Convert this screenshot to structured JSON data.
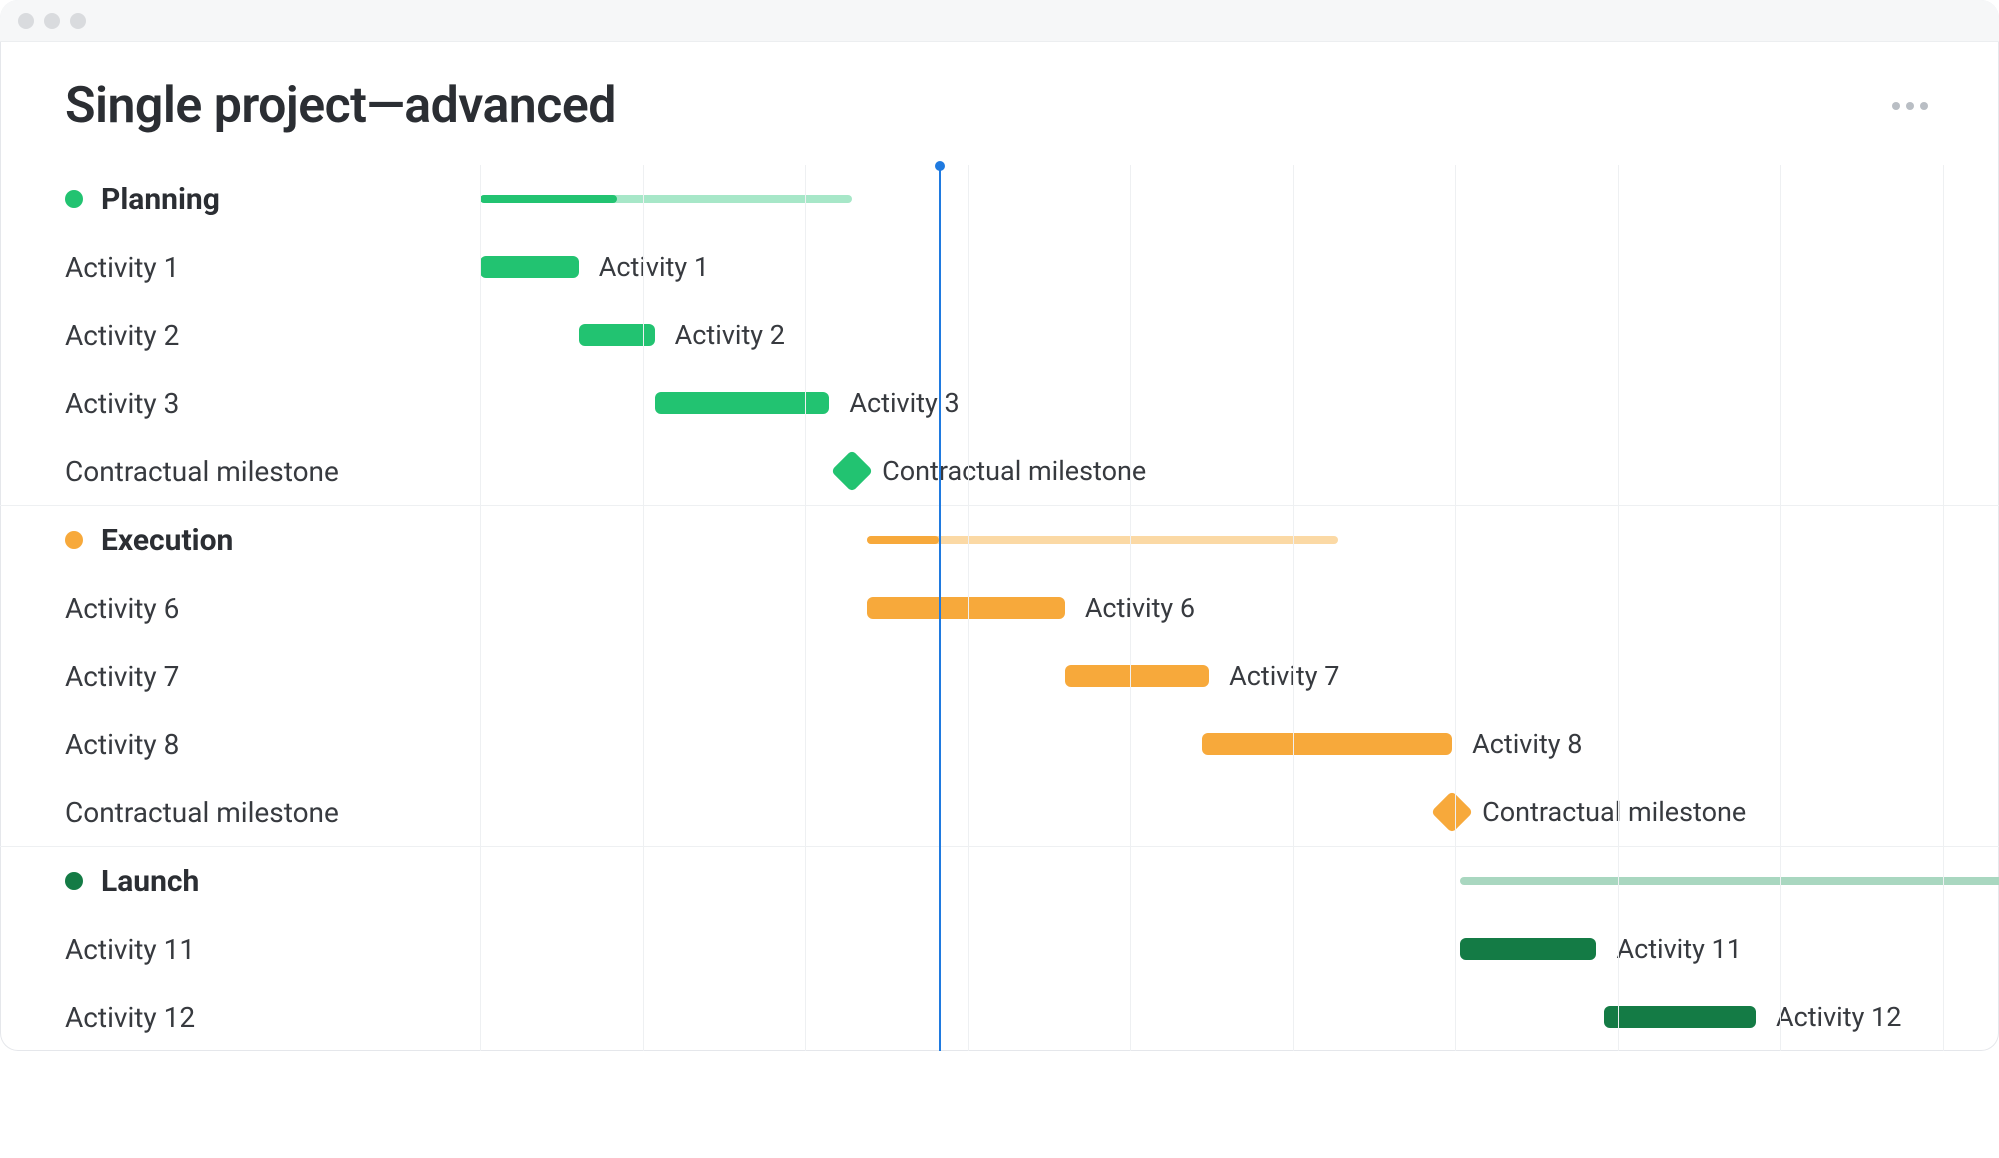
{
  "title": "Single project—advanced",
  "today_position_pct": 30.2,
  "grid_start_pct": 0,
  "grid_step_pct": 10.7,
  "grid_count": 10,
  "colors": {
    "planning": {
      "solid": "#22c371",
      "light": "#a7e7c8"
    },
    "execution": {
      "solid": "#f7a93b",
      "light": "#fbd9a5"
    },
    "launch": {
      "solid": "#147b45",
      "light": "#a9d7c0"
    },
    "today": "#1f7ae0"
  },
  "sections": [
    {
      "id": "planning",
      "name": "Planning",
      "color_key": "planning",
      "summary": {
        "start_pct": 0,
        "width_pct": 24.5,
        "progress_pct": 9.0
      },
      "rows": [
        {
          "type": "bar",
          "label": "Activity 1",
          "bar": {
            "start_pct": 0,
            "width_pct": 6.5
          },
          "bar_label": "Activity 1"
        },
        {
          "type": "bar",
          "label": "Activity 2",
          "bar": {
            "start_pct": 6.5,
            "width_pct": 5.0
          },
          "bar_label": "Activity 2"
        },
        {
          "type": "bar",
          "label": "Activity 3",
          "bar": {
            "start_pct": 11.5,
            "width_pct": 11.5
          },
          "bar_label": "Activity 3"
        },
        {
          "type": "milestone",
          "label": "Contractual milestone",
          "pos_pct": 24.5,
          "bar_label": "Contractual milestone"
        }
      ]
    },
    {
      "id": "execution",
      "name": "Execution",
      "color_key": "execution",
      "summary": {
        "start_pct": 25.5,
        "width_pct": 31.0,
        "progress_pct": 4.7
      },
      "rows": [
        {
          "type": "bar",
          "label": "Activity 6",
          "bar": {
            "start_pct": 25.5,
            "width_pct": 13.0
          },
          "bar_label": "Activity 6"
        },
        {
          "type": "bar",
          "label": "Activity 7",
          "bar": {
            "start_pct": 38.5,
            "width_pct": 9.5
          },
          "bar_label": "Activity 7"
        },
        {
          "type": "bar",
          "label": "Activity 8",
          "bar": {
            "start_pct": 47.5,
            "width_pct": 16.5
          },
          "bar_label": "Activity 8"
        },
        {
          "type": "milestone",
          "label": "Contractual milestone",
          "pos_pct": 64.0,
          "bar_label": "Contractual milestone"
        }
      ]
    },
    {
      "id": "launch",
      "name": "Launch",
      "color_key": "launch",
      "summary": {
        "start_pct": 64.5,
        "width_pct": 40.0,
        "progress_pct": 0
      },
      "rows": [
        {
          "type": "bar",
          "label": "Activity 11",
          "bar": {
            "start_pct": 64.5,
            "width_pct": 9.0
          },
          "bar_label": "Activity 11"
        },
        {
          "type": "bar",
          "label": "Activity 12",
          "bar": {
            "start_pct": 74.0,
            "width_pct": 10.0
          },
          "bar_label": "Activity 12"
        }
      ]
    }
  ],
  "chart_data": {
    "type": "bar",
    "title": "Single project—advanced",
    "today": 3.0,
    "x_range": [
      0,
      10
    ],
    "sections": [
      {
        "name": "Planning",
        "color": "#22c371",
        "summary": {
          "start": 0,
          "end": 2.3,
          "progress_end": 0.85
        },
        "activities": [
          {
            "name": "Activity 1",
            "start": 0.0,
            "end": 0.6
          },
          {
            "name": "Activity 2",
            "start": 0.6,
            "end": 1.1
          },
          {
            "name": "Activity 3",
            "start": 1.1,
            "end": 2.2
          }
        ],
        "milestones": [
          {
            "name": "Contractual milestone",
            "at": 2.3
          }
        ]
      },
      {
        "name": "Execution",
        "color": "#f7a93b",
        "summary": {
          "start": 2.4,
          "end": 5.3,
          "progress_end": 2.85
        },
        "activities": [
          {
            "name": "Activity 6",
            "start": 2.4,
            "end": 3.6
          },
          {
            "name": "Activity 7",
            "start": 3.6,
            "end": 4.5
          },
          {
            "name": "Activity 8",
            "start": 4.45,
            "end": 6.0
          }
        ],
        "milestones": [
          {
            "name": "Contractual milestone",
            "at": 6.0
          }
        ]
      },
      {
        "name": "Launch",
        "color": "#147b45",
        "summary": {
          "start": 6.05,
          "end": 10.0,
          "progress_end": 6.05
        },
        "activities": [
          {
            "name": "Activity 11",
            "start": 6.05,
            "end": 6.9
          },
          {
            "name": "Activity 12",
            "start": 6.95,
            "end": 7.85
          }
        ],
        "milestones": []
      }
    ]
  }
}
